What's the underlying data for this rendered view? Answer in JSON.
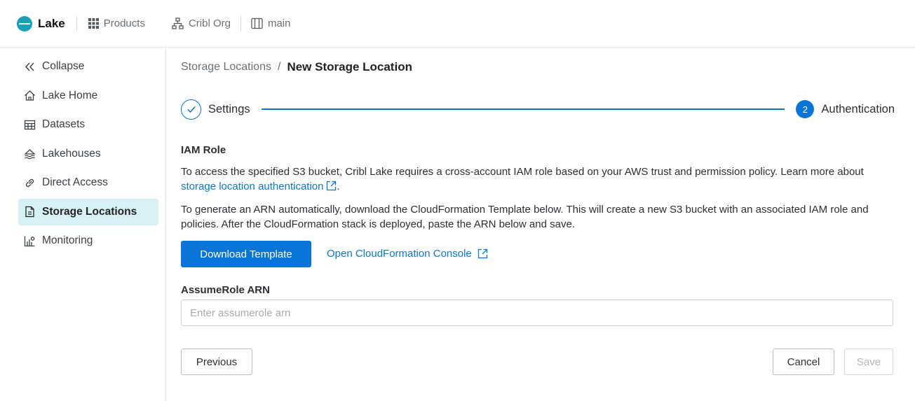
{
  "topbar": {
    "brand": "Lake",
    "products_label": "Products",
    "org_label": "Cribl Org",
    "workspace_label": "main"
  },
  "sidebar": {
    "items": [
      {
        "label": "Collapse",
        "icon": "double-chevron-left-icon"
      },
      {
        "label": "Lake Home",
        "icon": "home-icon"
      },
      {
        "label": "Datasets",
        "icon": "table-icon"
      },
      {
        "label": "Lakehouses",
        "icon": "lakehouse-icon"
      },
      {
        "label": "Direct Access",
        "icon": "link-icon"
      },
      {
        "label": "Storage Locations",
        "icon": "document-icon",
        "active": true
      },
      {
        "label": "Monitoring",
        "icon": "monitoring-icon"
      }
    ]
  },
  "breadcrumb": {
    "parent": "Storage Locations",
    "separator": "/",
    "current": "New Storage Location"
  },
  "stepper": {
    "step1_label": "Settings",
    "step2_number": "2",
    "step2_label": "Authentication"
  },
  "iam": {
    "title": "IAM Role",
    "para1_text": "To access the specified S3 bucket, Cribl Lake requires a cross-account IAM role based on your AWS trust and permission policy. Learn more about ",
    "para1_link": "storage location authentication",
    "para1_end": ".",
    "para2_text": "To generate an ARN automatically, download the CloudFormation Template below. This will create a new S3 bucket with an associated IAM role and policies. After the CloudFormation stack is deployed, paste the ARN below and save.",
    "download_button": "Download Template",
    "console_link": "Open CloudFormation Console"
  },
  "arn_field": {
    "label": "AssumeRole ARN",
    "placeholder": "Enter assumerole arn",
    "value": ""
  },
  "footer": {
    "previous_button": "Previous",
    "cancel_button": "Cancel",
    "save_button": "Save"
  },
  "colors": {
    "accent": "#0a75d6",
    "brand": "#1b9fb5",
    "active_nav_bg": "#d6f0f4"
  }
}
